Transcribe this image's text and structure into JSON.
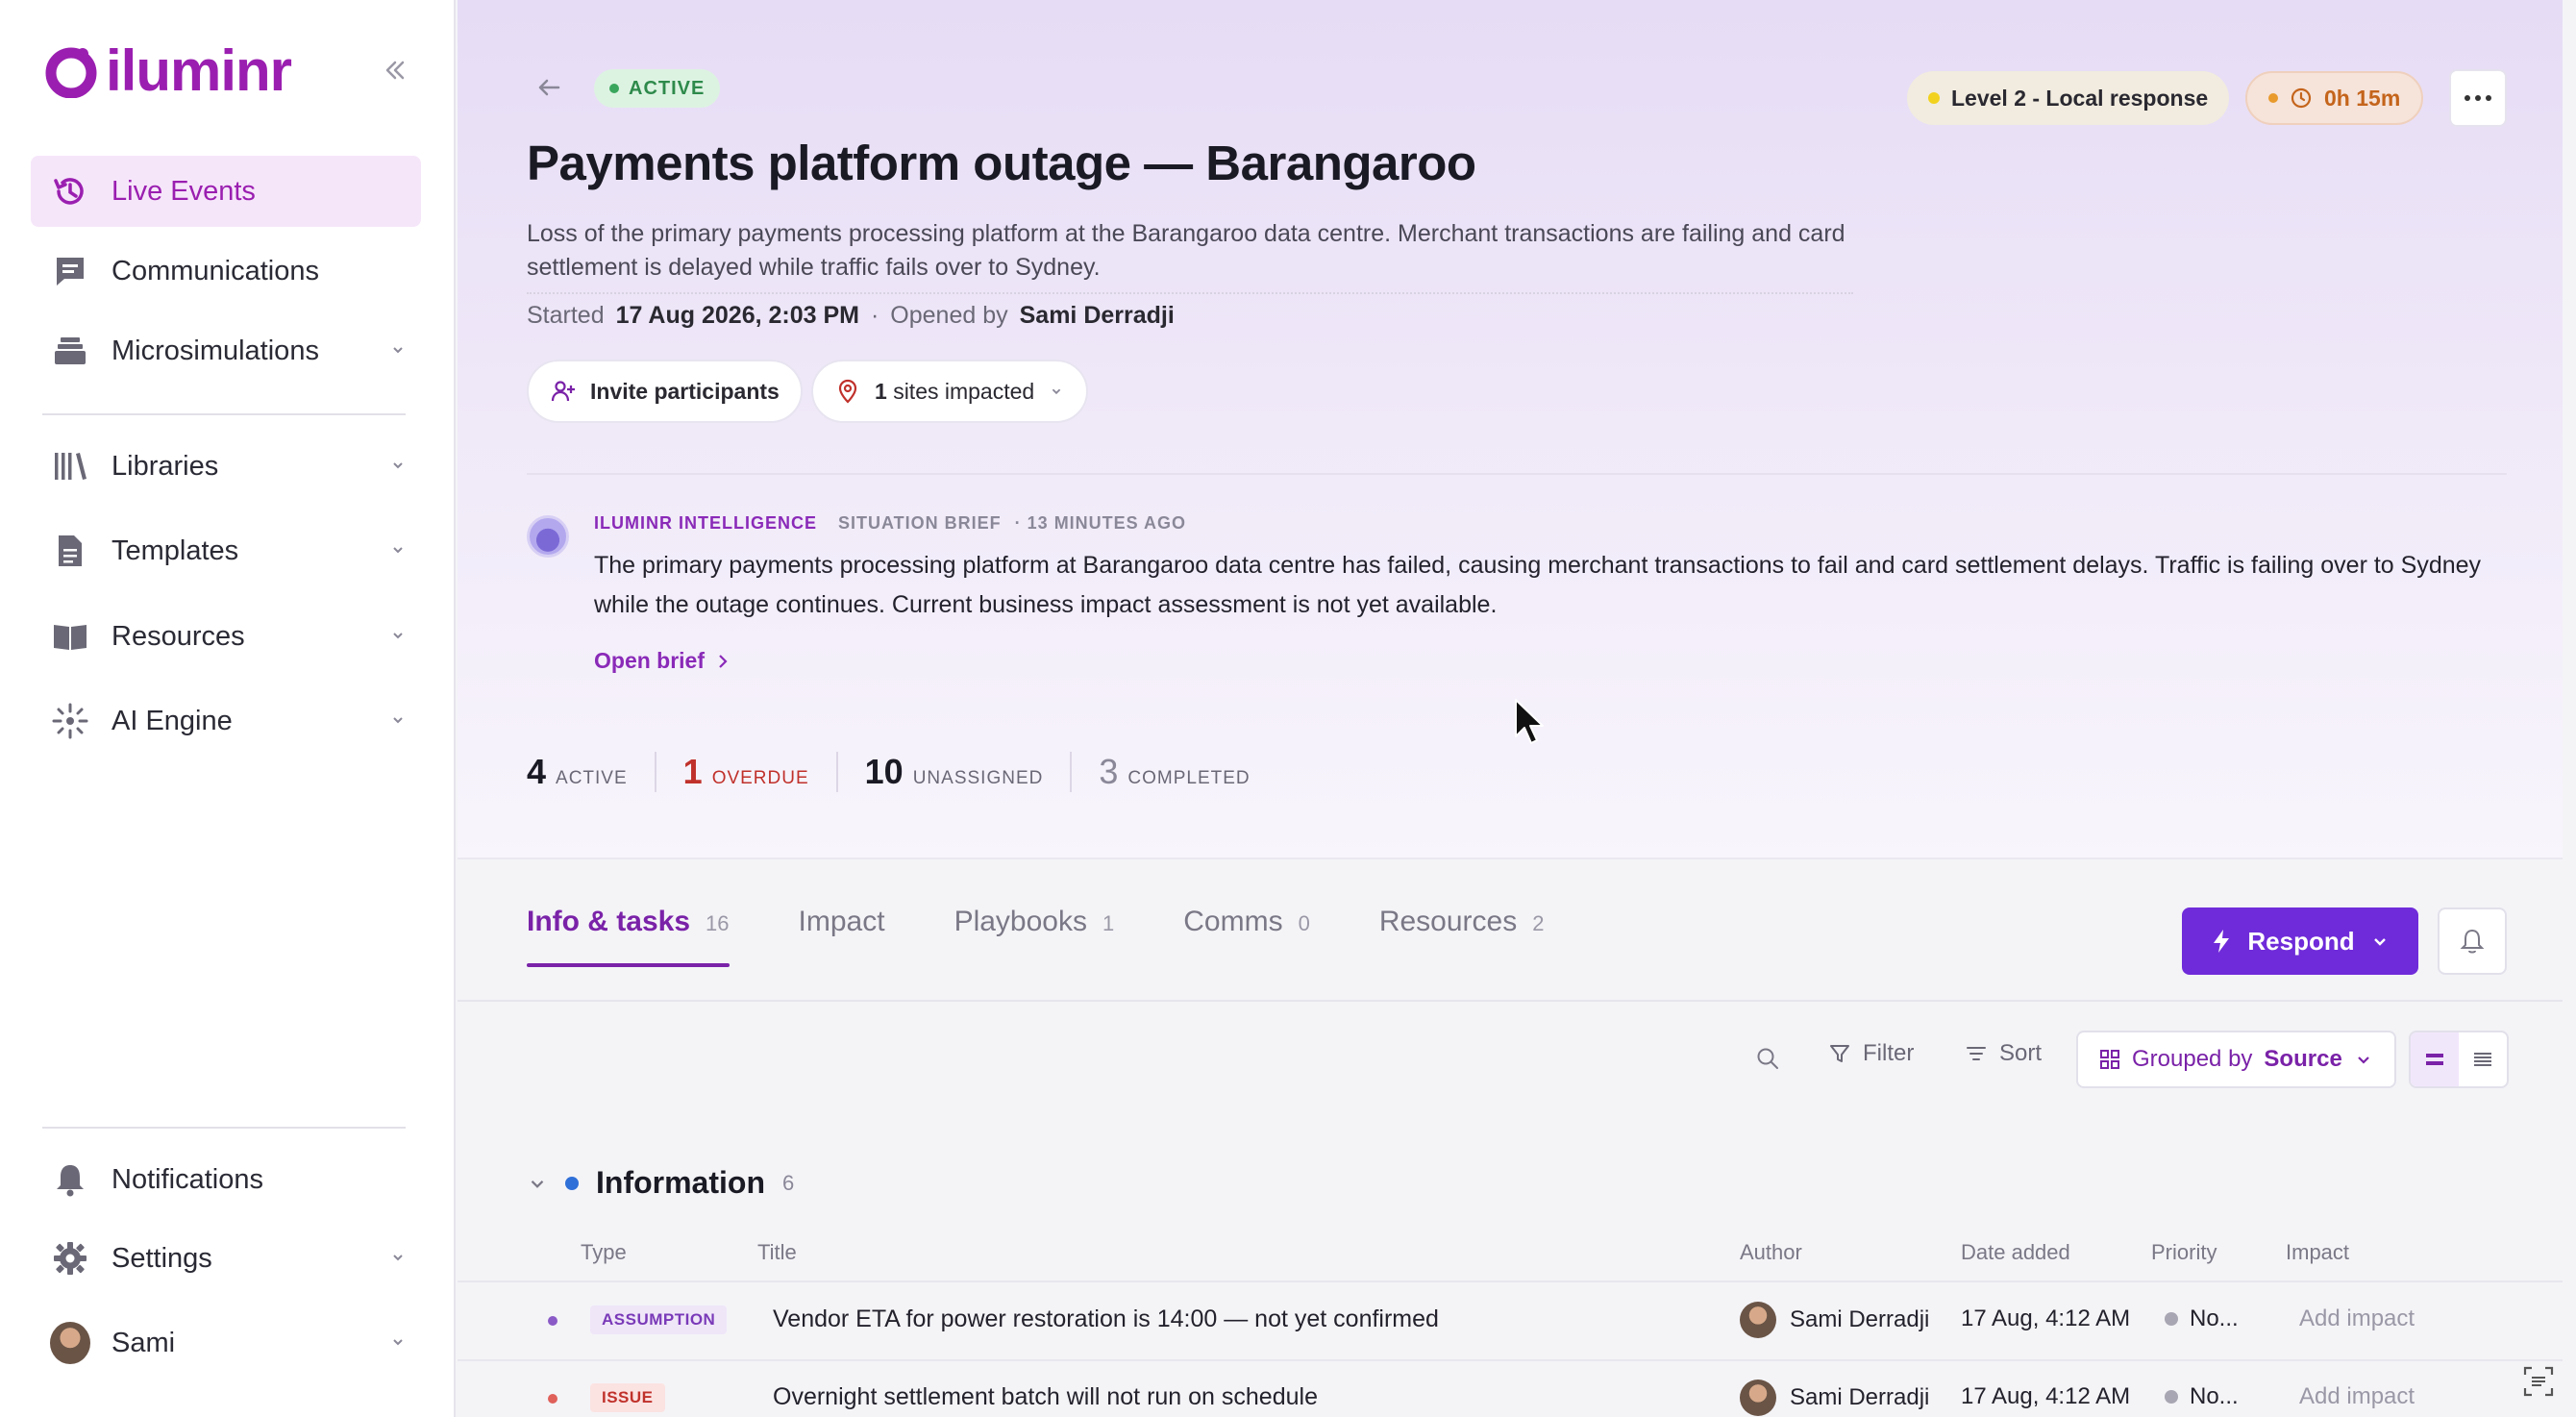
{
  "brand": {
    "name": "iluminr",
    "color": "#9a1fb0"
  },
  "sidebar": {
    "collapse_icon": "double-chevron-left-icon",
    "items": [
      {
        "label": "Live Events",
        "icon": "history-icon",
        "active": true
      },
      {
        "label": "Communications",
        "icon": "chat-icon"
      },
      {
        "label": "Microsimulations",
        "icon": "layers-icon",
        "expandable": true
      },
      {
        "label": "Libraries",
        "icon": "library-icon",
        "expandable": true
      },
      {
        "label": "Templates",
        "icon": "document-icon",
        "expandable": true
      },
      {
        "label": "Resources",
        "icon": "book-icon",
        "expandable": true
      },
      {
        "label": "AI Engine",
        "icon": "sparkle-icon",
        "expandable": true
      }
    ],
    "bottom": [
      {
        "label": "Notifications",
        "icon": "bell-icon"
      },
      {
        "label": "Settings",
        "icon": "gear-icon",
        "expandable": true
      },
      {
        "label": "Sami",
        "icon": "avatar",
        "expandable": true
      }
    ]
  },
  "event": {
    "status": "ACTIVE",
    "status_color": "#2e8a4b",
    "level": "Level 2 - Local response",
    "timer": "0h 15m",
    "title": "Payments platform outage — Barangaroo",
    "description": "Loss of the primary payments processing platform at the Barangaroo data centre. Merchant transactions are failing and card settlement is delayed while traffic fails over to Sydney.",
    "started_label": "Started",
    "started_value": "17 Aug 2026, 2:03 PM",
    "separator": "·",
    "opened_label": "Opened by",
    "opened_value": "Sami Derradji",
    "invite_label": "Invite participants",
    "sites_count": "1",
    "sites_label": "sites impacted"
  },
  "brief": {
    "source": "ILUMINR INTELLIGENCE",
    "kind": "SITUATION BRIEF",
    "time": "· 13 MINUTES AGO",
    "text": "The primary payments processing platform at Barangaroo data centre has failed, causing merchant transactions to fail and card settlement delays. Traffic is failing over to Sydney while the outage continues. Current business impact assessment is not yet available.",
    "link": "Open brief"
  },
  "stats": [
    {
      "num": "4",
      "label": "ACTIVE"
    },
    {
      "num": "1",
      "label": "OVERDUE",
      "color": "#c0312b"
    },
    {
      "num": "10",
      "label": "UNASSIGNED"
    },
    {
      "num": "3",
      "label": "COMPLETED"
    }
  ],
  "tabs": [
    {
      "label": "Info & tasks",
      "count": "16",
      "active": true
    },
    {
      "label": "Impact",
      "count": ""
    },
    {
      "label": "Playbooks",
      "count": "1"
    },
    {
      "label": "Comms",
      "count": "0"
    },
    {
      "label": "Resources",
      "count": "2"
    }
  ],
  "actions": {
    "respond": "Respond",
    "respond_color": "#6f2bd9"
  },
  "toolbar": {
    "filter": "Filter",
    "sort": "Sort",
    "grouped_prefix": "Grouped by",
    "grouped_value": "Source"
  },
  "group": {
    "title": "Information",
    "count": "6",
    "columns": [
      "Type",
      "Title",
      "Author",
      "Date added",
      "Priority",
      "Impact"
    ],
    "rows": [
      {
        "type": "ASSUMPTION",
        "type_color": "#7a3ab8",
        "title": "Vendor ETA for power restoration is 14:00 — not yet confirmed",
        "author": "Sami Derradji",
        "date": "17 Aug, 4:12 AM",
        "priority": "No...",
        "impact": "Add impact"
      },
      {
        "type": "ISSUE",
        "type_color": "#c0312b",
        "title": "Overnight settlement batch will not run on schedule",
        "author": "Sami Derradji",
        "date": "17 Aug, 4:12 AM",
        "priority": "No...",
        "impact": "Add impact"
      }
    ]
  }
}
